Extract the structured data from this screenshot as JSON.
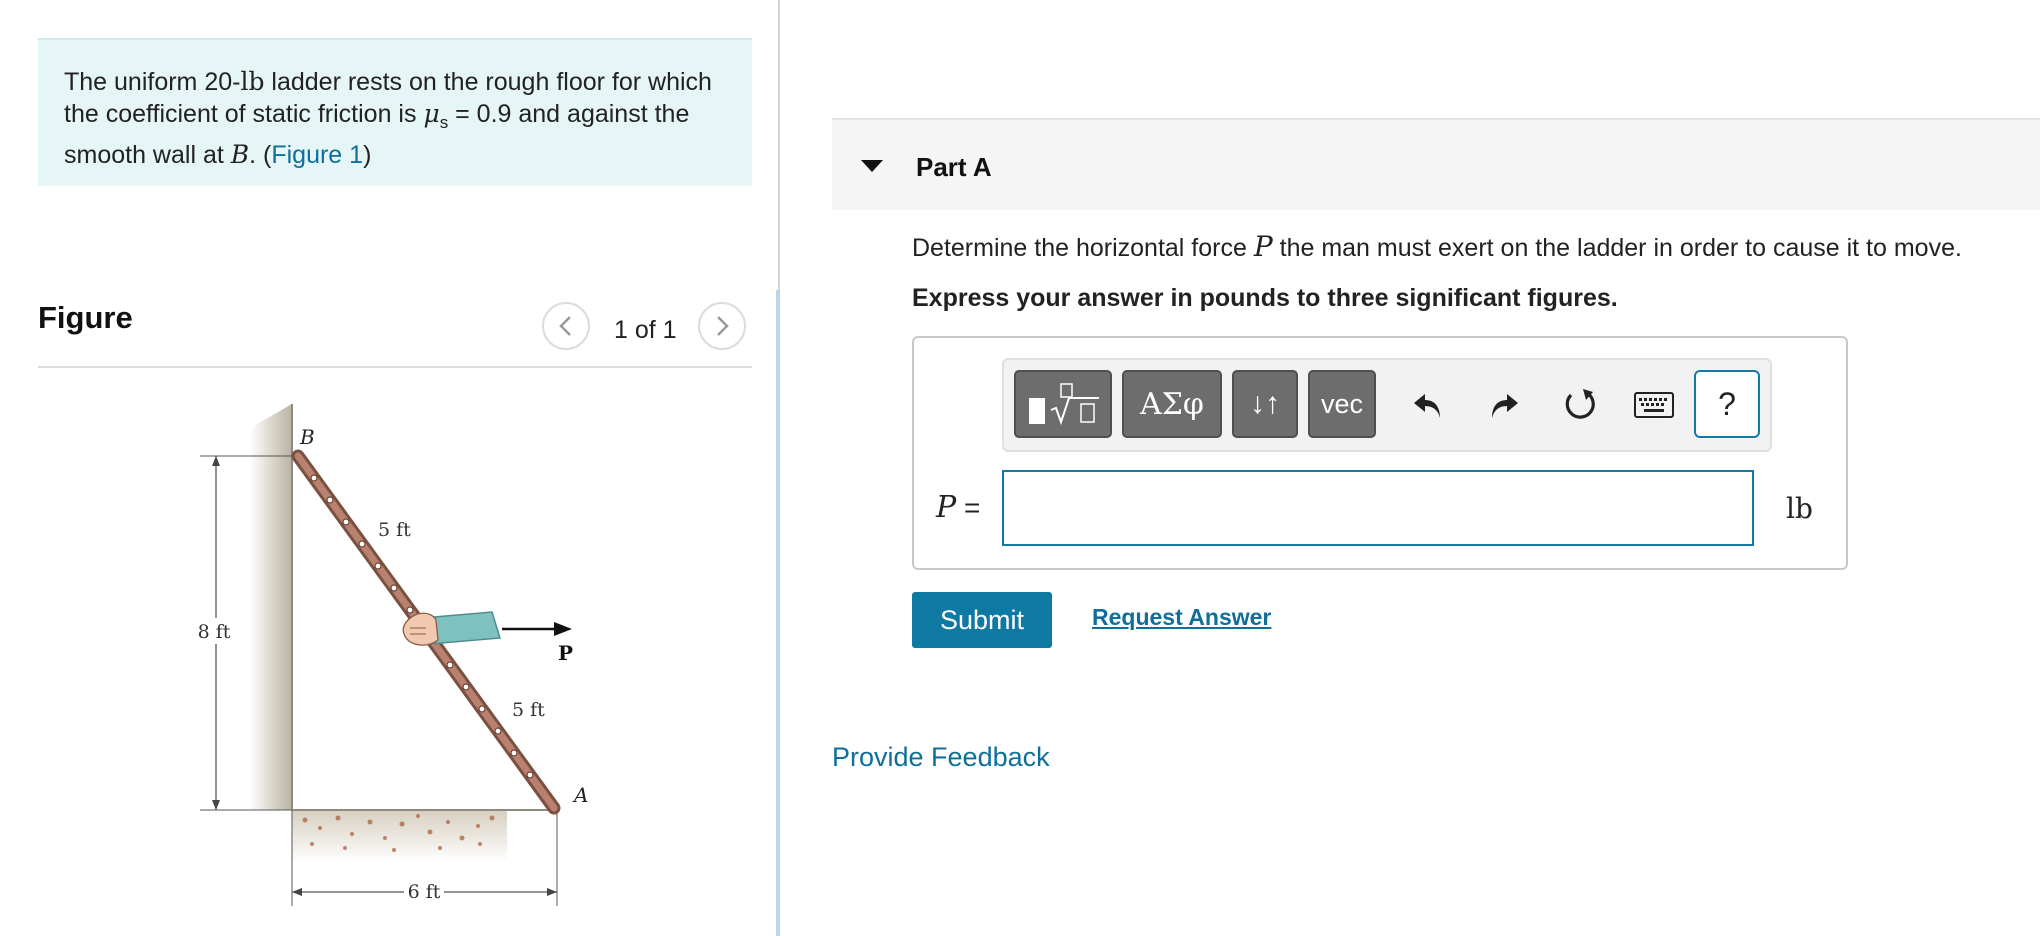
{
  "problem": {
    "text_part1": "The uniform 20-",
    "weight_unit": "lb",
    "text_part2": " ladder rests on the rough floor for which the coefficient of static friction is ",
    "mu_symbol": "μ",
    "mu_subscript": "s",
    "text_part3": " = 0.9 and against the smooth wall at ",
    "point_B": "B",
    "text_part4": ". (",
    "figure_link": "Figure 1",
    "text_part5": ")"
  },
  "figure": {
    "title": "Figure",
    "counter": "1 of 1",
    "labels": {
      "B": "B",
      "A": "A",
      "P": "P",
      "upper_length": "5 ft",
      "lower_length": "5 ft",
      "height": "8 ft",
      "base": "6 ft"
    }
  },
  "part": {
    "title": "Part A",
    "question_part1": "Determine the horizontal force ",
    "question_var": "P",
    "question_part2": " the man must exert on the ladder in order to cause it to move.",
    "instruction": "Express your answer in pounds to three significant figures."
  },
  "toolbar": {
    "templates_icon": "fraction-sqrt-templates-icon",
    "greek_label": "ΑΣφ",
    "arrows_label": "↓↑",
    "vec_label": "vec",
    "undo_icon": "undo-icon",
    "redo_icon": "redo-icon",
    "reset_icon": "reset-icon",
    "keyboard_icon": "keyboard-icon",
    "help_label": "?"
  },
  "answer": {
    "variable": "P",
    "equals": " =",
    "value": "",
    "unit": "lb"
  },
  "actions": {
    "submit_label": "Submit",
    "request_answer_label": "Request Answer",
    "feedback_label": "Provide Feedback"
  },
  "colors": {
    "accent": "#0e7aa3",
    "link": "#0e6f9b",
    "problem_bg": "#e6f6f6",
    "toolbar_btn": "#6d6d6d"
  }
}
